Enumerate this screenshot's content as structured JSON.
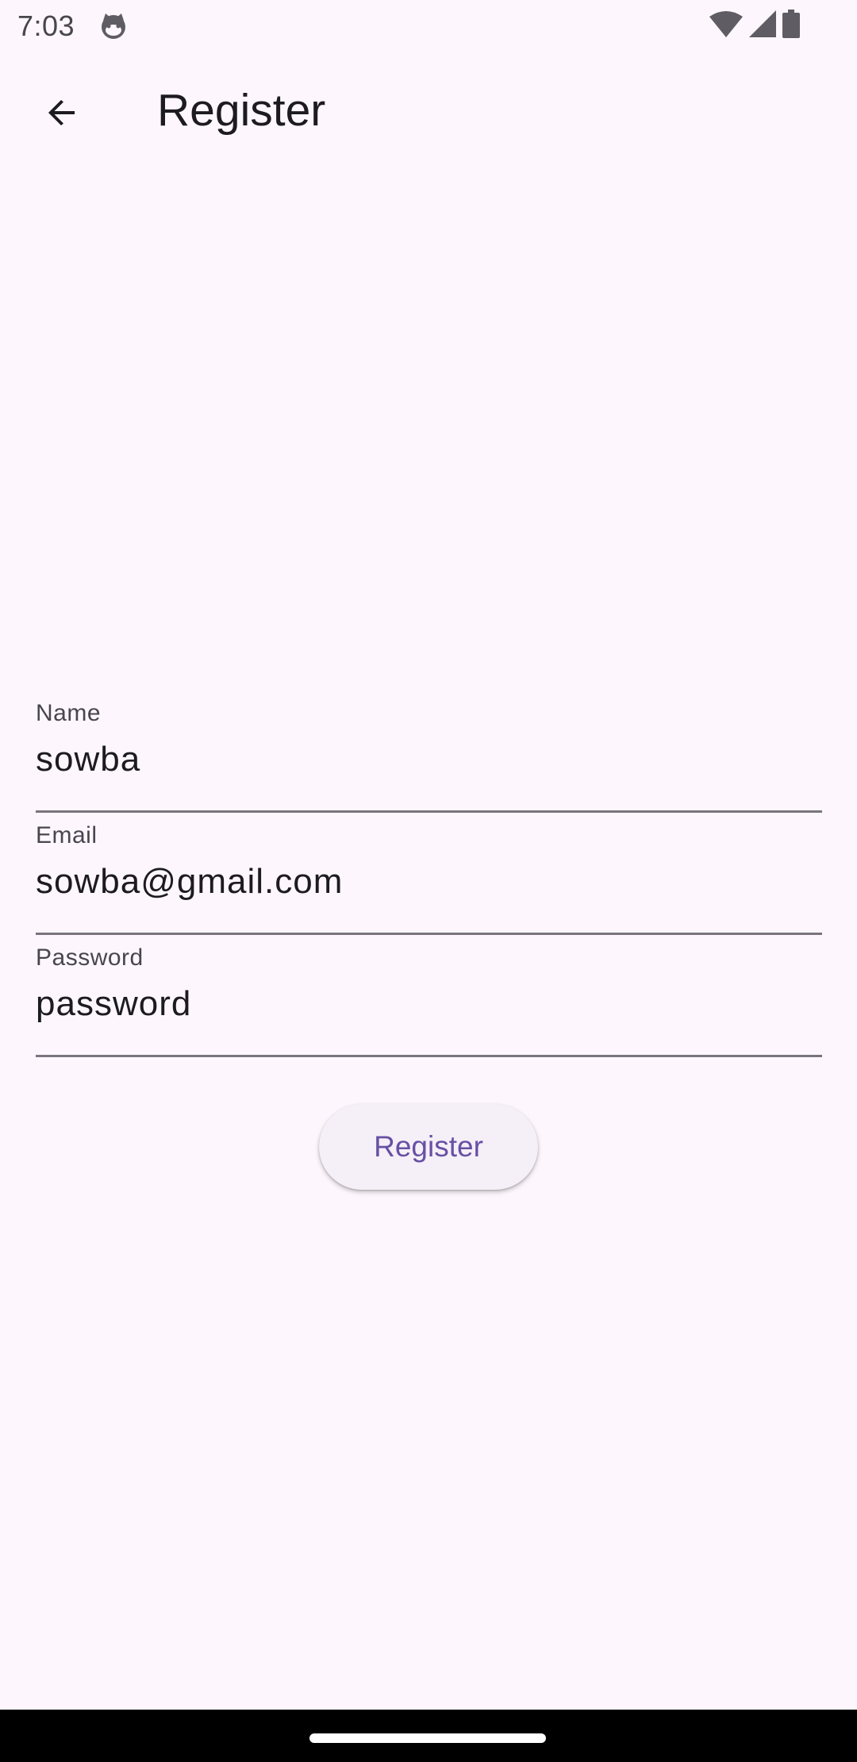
{
  "status_bar": {
    "time": "7:03",
    "icons": [
      "cat-notification-icon",
      "wifi-icon",
      "cellular-signal-icon",
      "battery-icon"
    ]
  },
  "app_bar": {
    "back_icon": "arrow-back-icon",
    "title": "Register"
  },
  "form": {
    "name": {
      "label": "Name",
      "value": "sowba"
    },
    "email": {
      "label": "Email",
      "value": "sowba@gmail.com"
    },
    "password": {
      "label": "Password",
      "value": "password"
    }
  },
  "actions": {
    "register_label": "Register"
  },
  "colors": {
    "background": "#fdf7fd",
    "primary": "#6750a4",
    "button_surface": "#f5eff7",
    "underline": "#79747e",
    "label": "#49454f",
    "text": "#1d1b20"
  }
}
